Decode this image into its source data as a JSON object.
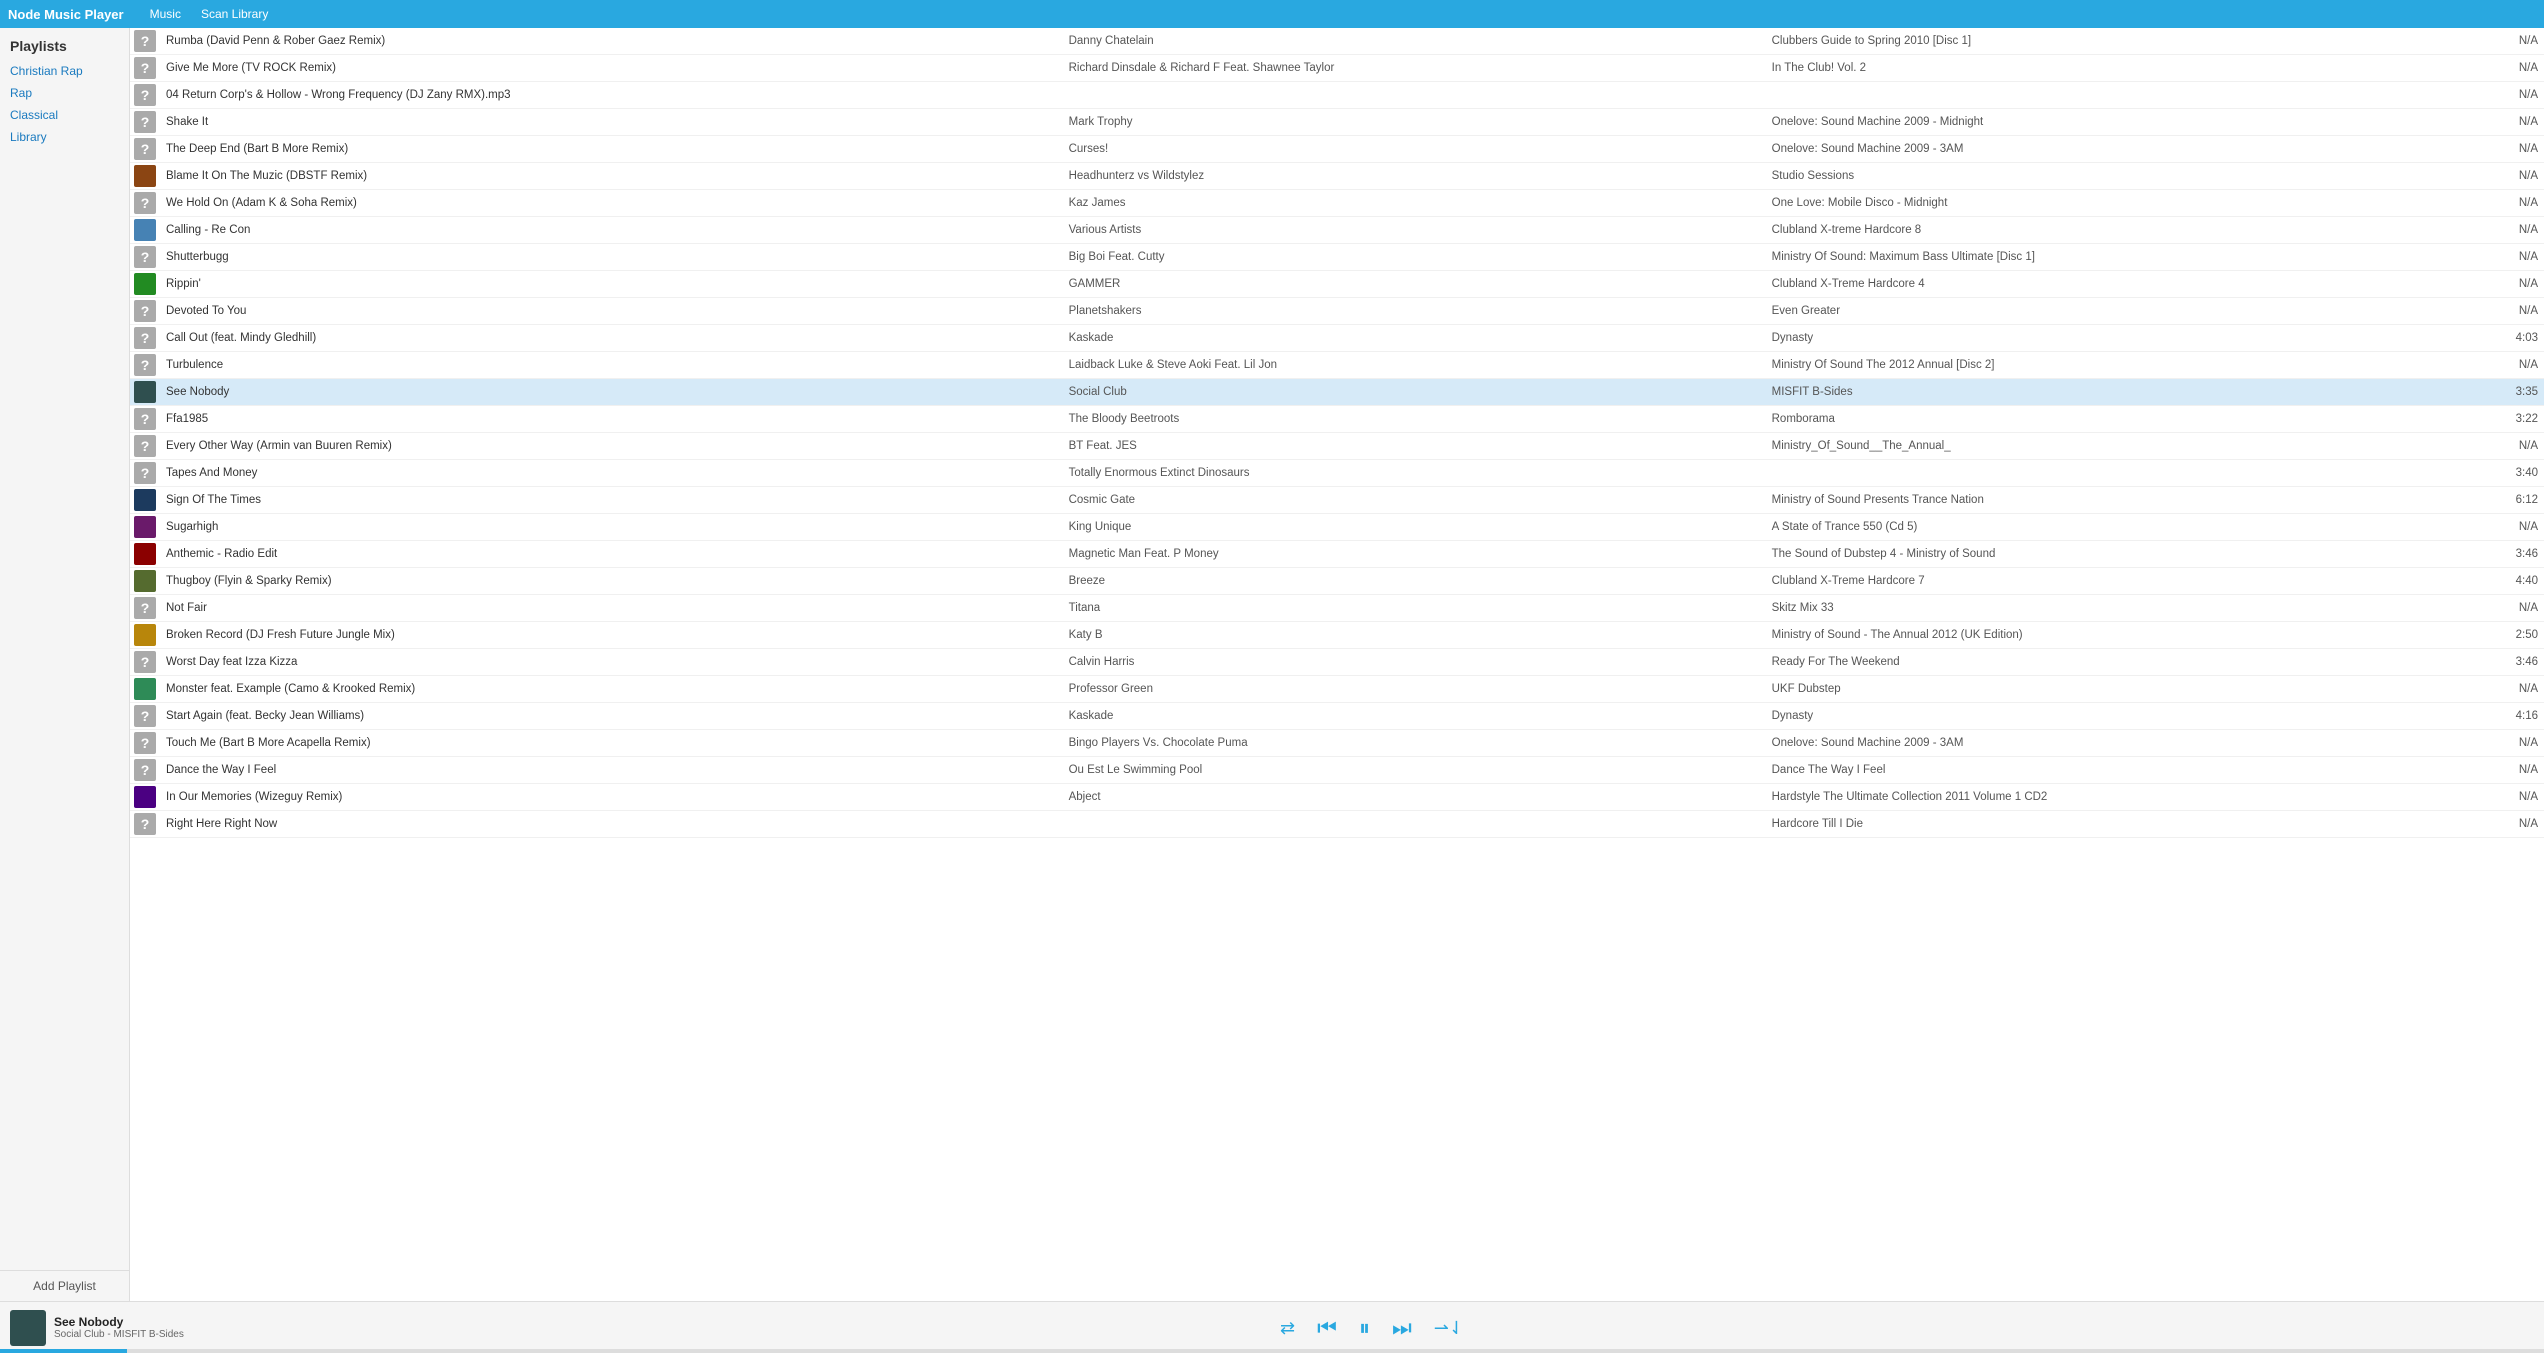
{
  "app": {
    "title": "Node Music Player",
    "nav": [
      {
        "label": "Music",
        "id": "music"
      },
      {
        "label": "Scan Library",
        "id": "scan-library"
      }
    ]
  },
  "sidebar": {
    "header": "Playlists",
    "items": [
      {
        "label": "Christian Rap",
        "id": "christian-rap"
      },
      {
        "label": "Rap",
        "id": "rap"
      },
      {
        "label": "Classical",
        "id": "classical"
      },
      {
        "label": "Library",
        "id": "library"
      }
    ],
    "add_label": "Add Playlist"
  },
  "tracks": [
    {
      "id": 1,
      "title": "Rumba (David Penn & Rober Gaez Remix)",
      "artist": "Danny Chatelain",
      "album": "Clubbers Guide to Spring 2010 [Disc 1]",
      "duration": "N/A",
      "hasArt": false,
      "selected": false
    },
    {
      "id": 2,
      "title": "Give Me More (TV ROCK Remix)",
      "artist": "Richard Dinsdale & Richard F Feat. Shawnee Taylor",
      "album": "In The Club! Vol. 2",
      "duration": "N/A",
      "hasArt": false,
      "selected": false
    },
    {
      "id": 3,
      "title": "04 Return Corp's & Hollow - Wrong Frequency (DJ Zany RMX).mp3",
      "artist": "",
      "album": "",
      "duration": "N/A",
      "hasArt": false,
      "selected": false
    },
    {
      "id": 4,
      "title": "Shake It",
      "artist": "Mark Trophy",
      "album": "Onelove: Sound Machine 2009 - Midnight",
      "duration": "N/A",
      "hasArt": false,
      "selected": false
    },
    {
      "id": 5,
      "title": "The Deep End (Bart B More Remix)",
      "artist": "Curses!",
      "album": "Onelove: Sound Machine 2009 - 3AM",
      "duration": "N/A",
      "hasArt": false,
      "selected": false
    },
    {
      "id": 6,
      "title": "Blame It On The Muzic (DBSTF Remix)",
      "artist": "Headhunterz vs Wildstylez",
      "album": "Studio Sessions",
      "duration": "N/A",
      "hasArt": true,
      "artColor": "#8B4513",
      "selected": false
    },
    {
      "id": 7,
      "title": "We Hold On (Adam K & Soha Remix)",
      "artist": "Kaz James",
      "album": "One Love: Mobile Disco - Midnight",
      "duration": "N/A",
      "hasArt": false,
      "selected": false
    },
    {
      "id": 8,
      "title": "Calling - Re Con",
      "artist": "Various Artists",
      "album": "Clubland X-treme Hardcore 8",
      "duration": "N/A",
      "hasArt": true,
      "artColor": "#4682B4",
      "selected": false
    },
    {
      "id": 9,
      "title": "Shutterbugg",
      "artist": "Big Boi Feat. Cutty",
      "album": "Ministry Of Sound: Maximum Bass Ultimate [Disc 1]",
      "duration": "N/A",
      "hasArt": false,
      "selected": false
    },
    {
      "id": 10,
      "title": "Rippin'",
      "artist": "GAMMER",
      "album": "Clubland X-Treme Hardcore 4",
      "duration": "N/A",
      "hasArt": true,
      "artColor": "#228B22",
      "selected": false
    },
    {
      "id": 11,
      "title": "Devoted To You",
      "artist": "Planetshakers",
      "album": "Even Greater",
      "duration": "N/A",
      "hasArt": false,
      "selected": false
    },
    {
      "id": 12,
      "title": "Call Out (feat. Mindy Gledhill)",
      "artist": "Kaskade",
      "album": "Dynasty",
      "duration": "4:03",
      "hasArt": false,
      "selected": false
    },
    {
      "id": 13,
      "title": "Turbulence",
      "artist": "Laidback Luke & Steve Aoki Feat. Lil Jon",
      "album": "Ministry Of Sound The 2012 Annual [Disc 2]",
      "duration": "N/A",
      "hasArt": false,
      "selected": false
    },
    {
      "id": 14,
      "title": "See Nobody",
      "artist": "Social Club",
      "album": "MISFIT B-Sides",
      "duration": "3:35",
      "hasArt": true,
      "artColor": "#2F4F4F",
      "selected": true
    },
    {
      "id": 15,
      "title": "Ffa1985",
      "artist": "The Bloody Beetroots",
      "album": "Romborama",
      "duration": "3:22",
      "hasArt": false,
      "selected": false
    },
    {
      "id": 16,
      "title": "Every Other Way (Armin van Buuren Remix)",
      "artist": "BT Feat. JES",
      "album": "Ministry_Of_Sound__The_Annual_",
      "duration": "N/A",
      "hasArt": false,
      "selected": false
    },
    {
      "id": 17,
      "title": "Tapes And Money",
      "artist": "Totally Enormous Extinct Dinosaurs",
      "album": "",
      "duration": "3:40",
      "hasArt": false,
      "selected": false
    },
    {
      "id": 18,
      "title": "Sign Of The Times",
      "artist": "Cosmic Gate",
      "album": "Ministry of Sound Presents Trance Nation",
      "duration": "6:12",
      "hasArt": true,
      "artColor": "#1C3A5E",
      "selected": false
    },
    {
      "id": 19,
      "title": "Sugarhigh",
      "artist": "King Unique",
      "album": "A State of Trance 550 (Cd 5)",
      "duration": "N/A",
      "hasArt": true,
      "artColor": "#6A1A6A",
      "selected": false
    },
    {
      "id": 20,
      "title": "Anthemic - Radio Edit",
      "artist": "Magnetic Man Feat. P Money",
      "album": "The Sound of Dubstep 4 - Ministry of Sound",
      "duration": "3:46",
      "hasArt": true,
      "artColor": "#8B0000",
      "selected": false
    },
    {
      "id": 21,
      "title": "Thugboy (Flyin & Sparky Remix)",
      "artist": "Breeze",
      "album": "Clubland X-Treme Hardcore 7",
      "duration": "4:40",
      "hasArt": true,
      "artColor": "#556B2F",
      "selected": false
    },
    {
      "id": 22,
      "title": "Not Fair",
      "artist": "Titana",
      "album": "Skitz Mix 33",
      "duration": "N/A",
      "hasArt": false,
      "selected": false
    },
    {
      "id": 23,
      "title": "Broken Record (DJ Fresh Future Jungle Mix)",
      "artist": "Katy B",
      "album": "Ministry of Sound - The Annual 2012 (UK Edition)",
      "duration": "2:50",
      "hasArt": true,
      "artColor": "#B8860B",
      "selected": false
    },
    {
      "id": 24,
      "title": "Worst Day feat Izza Kizza",
      "artist": "Calvin Harris",
      "album": "Ready For The Weekend",
      "duration": "3:46",
      "hasArt": false,
      "selected": false
    },
    {
      "id": 25,
      "title": "Monster feat. Example (Camo & Krooked Remix)",
      "artist": "Professor Green",
      "album": "UKF Dubstep",
      "duration": "N/A",
      "hasArt": true,
      "artColor": "#2E8B57",
      "selected": false
    },
    {
      "id": 26,
      "title": "Start Again (feat. Becky Jean Williams)",
      "artist": "Kaskade",
      "album": "Dynasty",
      "duration": "4:16",
      "hasArt": false,
      "selected": false
    },
    {
      "id": 27,
      "title": "Touch Me (Bart B More Acapella Remix)",
      "artist": "Bingo Players Vs. Chocolate Puma",
      "album": "Onelove: Sound Machine 2009 - 3AM",
      "duration": "N/A",
      "hasArt": false,
      "selected": false
    },
    {
      "id": 28,
      "title": "Dance the Way I Feel",
      "artist": "Ou Est Le Swimming Pool",
      "album": "Dance The Way I Feel",
      "duration": "N/A",
      "hasArt": false,
      "selected": false
    },
    {
      "id": 29,
      "title": "In Our Memories (Wizeguy Remix)",
      "artist": "Abject",
      "album": "Hardstyle The Ultimate Collection 2011 Volume 1 CD2",
      "duration": "N/A",
      "hasArt": true,
      "artColor": "#4B0082",
      "selected": false
    },
    {
      "id": 30,
      "title": "Right Here Right Now",
      "artist": "",
      "album": "Hardcore Till I Die",
      "duration": "N/A",
      "hasArt": false,
      "selected": false
    }
  ],
  "player": {
    "song_title": "See Nobody",
    "song_sub": "Social Club - MISFIT B-Sides",
    "thumb_color": "#2F4F4F",
    "controls": {
      "repeat": "⇄",
      "prev": "⏮",
      "pause": "⏸",
      "next": "⏭",
      "shuffle": "⇀"
    },
    "progress": 5
  }
}
